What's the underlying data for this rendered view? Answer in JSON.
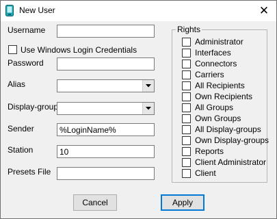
{
  "window": {
    "title": "New User",
    "close_glyph": "✕",
    "icon": "app-icon"
  },
  "form": {
    "username_label": "Username",
    "username_value": "",
    "windows_login_label": "Use Windows Login Credentials",
    "windows_login_checked": false,
    "password_label": "Password",
    "password_value": "",
    "alias_label": "Alias",
    "alias_value": "",
    "display_group_label": "Display-group",
    "display_group_value": "",
    "sender_label": "Sender",
    "sender_value": "%LoginName%",
    "station_label": "Station",
    "station_value": "10",
    "presets_label": "Presets File",
    "presets_value": ""
  },
  "rights": {
    "title": "Rights",
    "items": [
      {
        "label": "Administrator",
        "checked": false
      },
      {
        "label": "Interfaces",
        "checked": false
      },
      {
        "label": "Connectors",
        "checked": false
      },
      {
        "label": "Carriers",
        "checked": false
      },
      {
        "label": "All Recipients",
        "checked": false
      },
      {
        "label": "Own Recipients",
        "checked": false
      },
      {
        "label": "All Groups",
        "checked": false
      },
      {
        "label": "Own Groups",
        "checked": false
      },
      {
        "label": "All Display-groups",
        "checked": false
      },
      {
        "label": "Own Display-groups",
        "checked": false
      },
      {
        "label": "Reports",
        "checked": false
      },
      {
        "label": "Client Administrator",
        "checked": false
      },
      {
        "label": "Client",
        "checked": false
      }
    ]
  },
  "buttons": {
    "cancel": "Cancel",
    "apply": "Apply"
  }
}
